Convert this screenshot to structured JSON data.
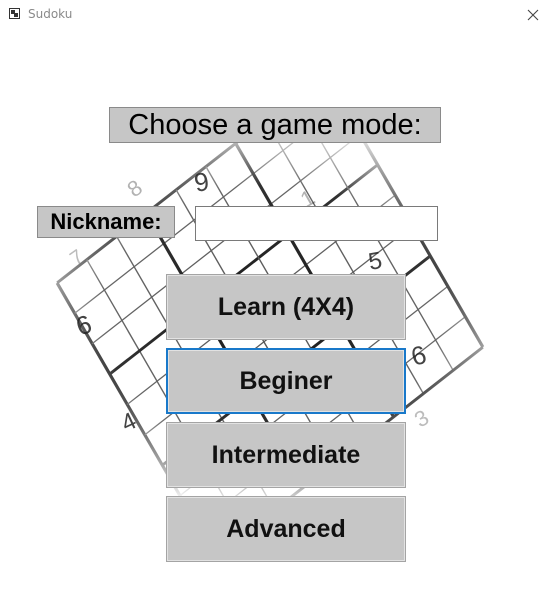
{
  "window": {
    "title": "Sudoku",
    "icon": "sudoku-app-icon",
    "close_icon": "close-icon"
  },
  "heading": "Choose a game mode:",
  "nickname": {
    "label": "Nickname:",
    "value": "",
    "placeholder": ""
  },
  "modes": [
    {
      "label": "Learn (4X4)",
      "focused": false
    },
    {
      "label": "Beginer",
      "focused": true
    },
    {
      "label": "Intermediate",
      "focused": false
    },
    {
      "label": "Advanced",
      "focused": false
    }
  ],
  "background_digits": [
    "9",
    "8",
    "1",
    "7",
    "5",
    "6",
    "6",
    "4",
    "3"
  ],
  "colors": {
    "panel": "#c6c6c6",
    "focus": "#1979ca"
  }
}
